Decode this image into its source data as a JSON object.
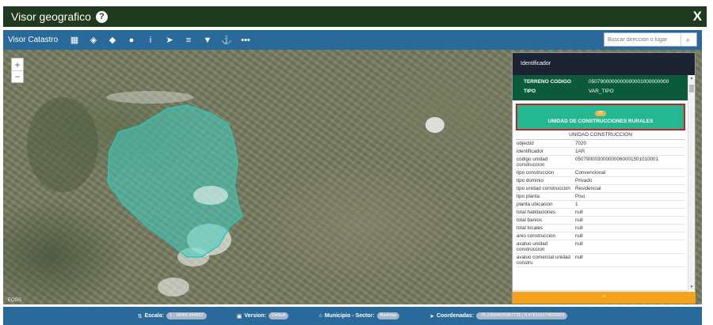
{
  "window": {
    "title": "Visor geografico",
    "help_icon": "?",
    "close_label": "X"
  },
  "toolbar": {
    "app_name": "Visor Catastro",
    "tools": [
      {
        "name": "grid-icon",
        "glyph": "▦"
      },
      {
        "name": "layers-icon",
        "glyph": "◈"
      },
      {
        "name": "eraser-icon",
        "glyph": "◆"
      },
      {
        "name": "record-icon",
        "glyph": "●"
      },
      {
        "name": "info-icon",
        "glyph": "i"
      },
      {
        "name": "navigate-icon",
        "glyph": "➤"
      },
      {
        "name": "list-icon",
        "glyph": "≡"
      },
      {
        "name": "filter-icon",
        "glyph": "▼"
      },
      {
        "name": "anchor-icon",
        "glyph": "⚓"
      },
      {
        "name": "more-icon",
        "glyph": "•••"
      }
    ],
    "search_placeholder": "Buscar dirección o lugar"
  },
  "map": {
    "zoom_in": "+",
    "zoom_out": "−",
    "crs_label": "ECGS",
    "polygon_color": "#3fd0c0"
  },
  "panel": {
    "header": "Identificador",
    "green_rows": [
      {
        "k": "TERRENO CODIGO",
        "v": "0507900000000000001000000000"
      },
      {
        "k": "TIPO",
        "v": "VAR_TIPO"
      }
    ],
    "unit_button": {
      "badge": "22",
      "label": "UNIDAD DE CONSTRUCCIONES RURALES"
    },
    "section_title": "UNIDAD CONSTRUCCION",
    "attributes": [
      {
        "k": "objectid",
        "v": "7020"
      },
      {
        "k": "identificador",
        "v": "1AR"
      },
      {
        "k": "codigo unidad construccion",
        "v": "050790003000000060001501010001"
      },
      {
        "k": "tipo construccion",
        "v": "Convencional"
      },
      {
        "k": "tipo dominio",
        "v": "Privado"
      },
      {
        "k": "tipo unidad construccion",
        "v": "Residencial"
      },
      {
        "k": "tipo planta",
        "v": "Piso"
      },
      {
        "k": "planta ubicacion",
        "v": "1"
      },
      {
        "k": "total habitaciones",
        "v": "null"
      },
      {
        "k": "total banios",
        "v": "null"
      },
      {
        "k": "total locales",
        "v": "null"
      },
      {
        "k": "anio construccion",
        "v": "null"
      },
      {
        "k": "avaluo unidad construccion",
        "v": "null"
      },
      {
        "k": "avaluo comercial unidad constru",
        "v": "null"
      }
    ],
    "collapse_icon": "^"
  },
  "statusbar": {
    "scale_label": "Escala:",
    "scale_value": "1 : 18055.954822",
    "version_label": "Version:",
    "version_value": "Default",
    "municipio_label": "Municipio - Sector:",
    "municipio_value": "Barbosa",
    "coords_label": "Coordenadas:",
    "coords_value": "-75.23034025987725 | 6.476103174826603"
  }
}
